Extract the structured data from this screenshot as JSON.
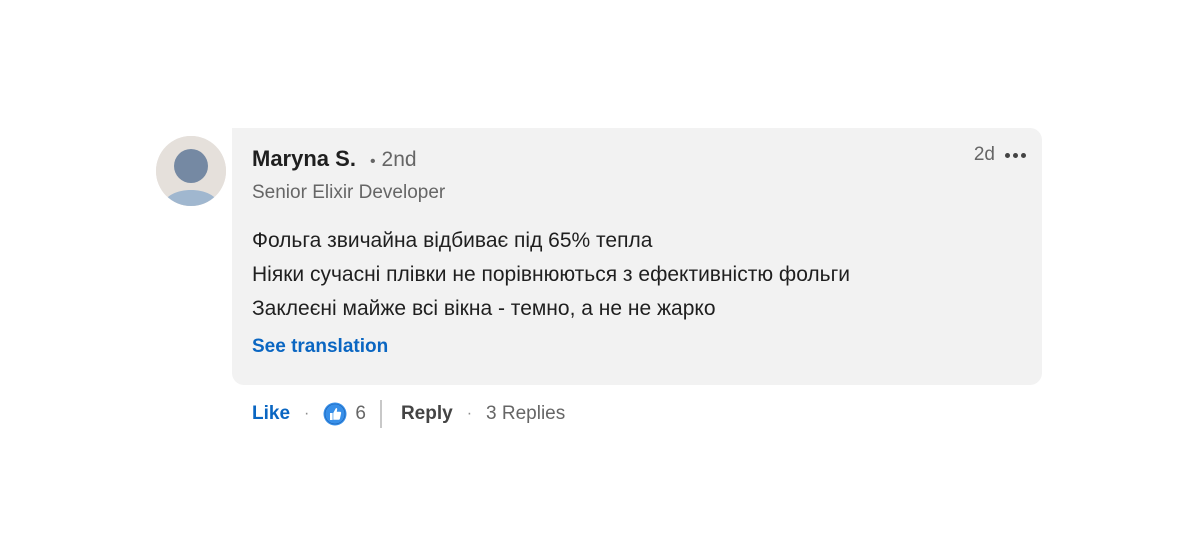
{
  "comment": {
    "author": {
      "name": "Maryna S.",
      "degree": "2nd",
      "headline": "Senior Elixir Developer",
      "avatar_icon": "default-avatar-icon"
    },
    "time": "2d",
    "more_icon": "ellipsis-icon",
    "body_lines": [
      "Фольга звичайна відбиває під 65% тепла",
      "Ніяки сучасні плівки не порівнюються з ефективністю фольги",
      "Заклеєні майже всі вікна - темно, а не не жарко"
    ],
    "see_translation": "See translation"
  },
  "actions": {
    "like_label": "Like",
    "reaction_icon": "thumbs-up-reaction-icon",
    "reaction_count": "6",
    "reply_label": "Reply",
    "replies_label": "3 Replies"
  },
  "colors": {
    "link_blue": "#0a66c2",
    "bubble_bg": "#f2f2f2",
    "text_primary": "#1f1f1f",
    "text_secondary": "#666666"
  }
}
